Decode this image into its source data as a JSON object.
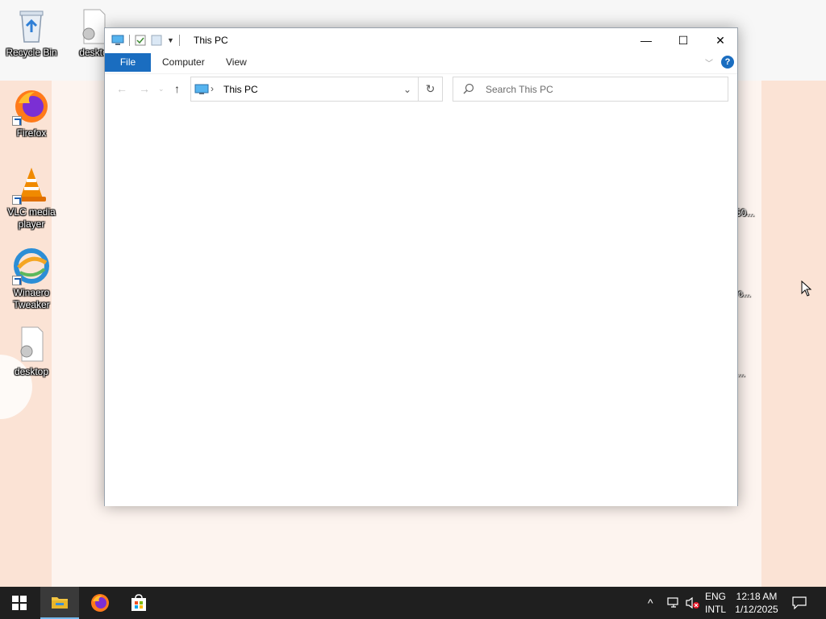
{
  "desktop": {
    "icons": [
      {
        "label": "Recycle Bin"
      },
      {
        "label": "deskto"
      },
      {
        "label": "Firefox"
      },
      {
        "label": "VLC media player"
      },
      {
        "label": "Winaero Tweaker"
      },
      {
        "label": "desktop"
      }
    ],
    "edge_labels": [
      "50...",
      "c...",
      "..."
    ]
  },
  "window": {
    "title": "This PC",
    "controls": {
      "minimize": "—",
      "maximize": "☐",
      "close": "✕"
    },
    "ribbon_tabs": [
      "File",
      "Computer",
      "View"
    ],
    "address": {
      "location": "This PC"
    },
    "search": {
      "placeholder": "Search This PC"
    }
  },
  "taskbar": {
    "apps": [
      "start",
      "file-explorer",
      "firefox",
      "microsoft-store"
    ],
    "language": {
      "line1": "ENG",
      "line2": "INTL"
    },
    "clock": {
      "time": "12:18 AM",
      "date": "1/12/2025"
    }
  },
  "colors": {
    "accent": "#1a6dc0",
    "taskbar": "#1f1f1f",
    "wallpaper": "#fbe3d5"
  }
}
